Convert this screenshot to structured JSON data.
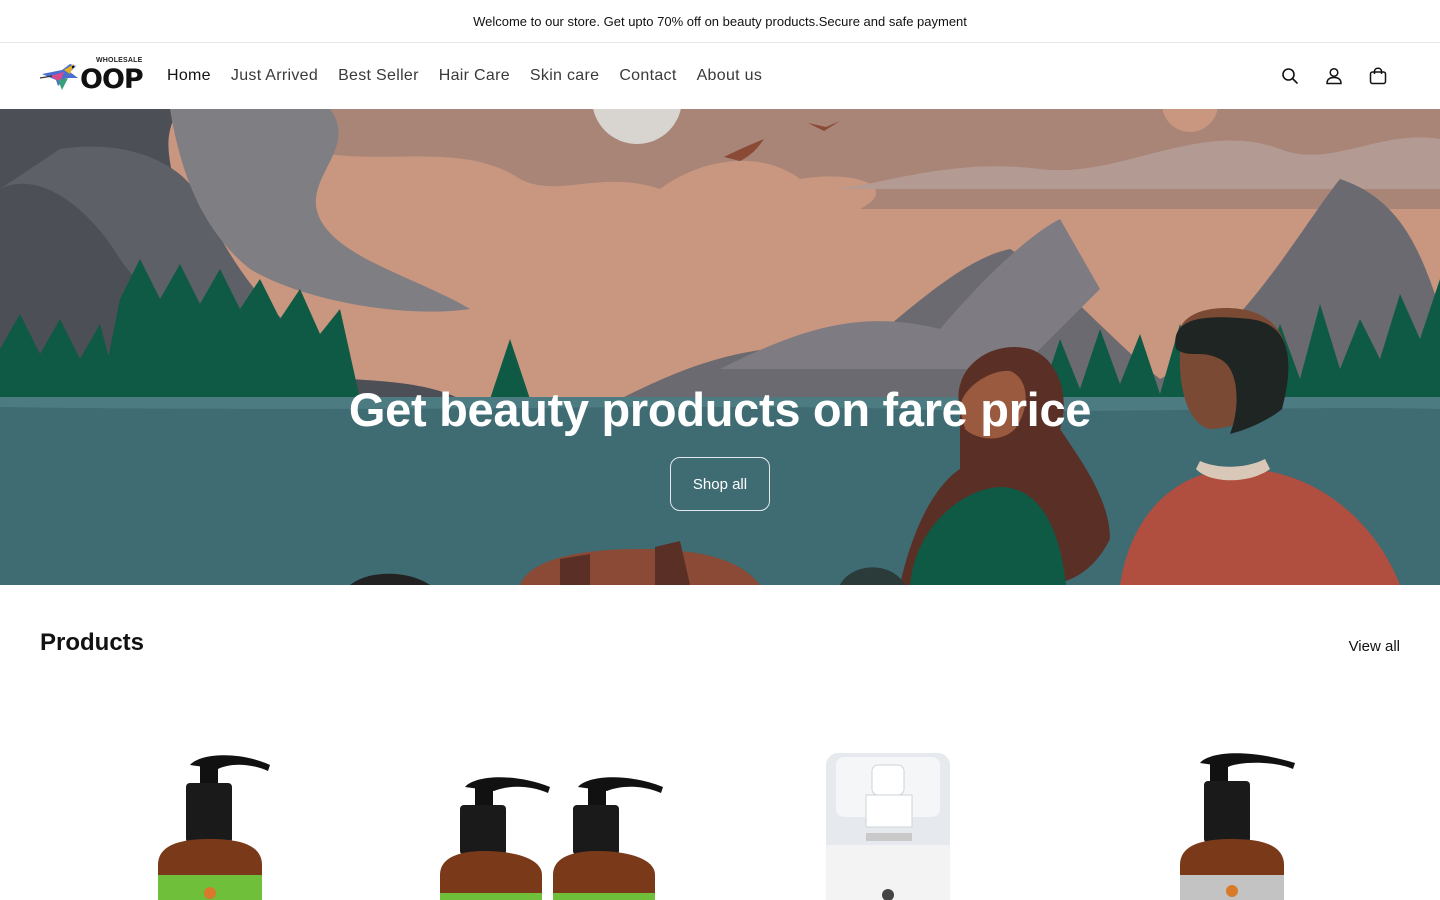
{
  "announcement": {
    "text": "Welcome to our store. Get upto 70% off on beauty products.Secure and safe payment"
  },
  "header": {
    "logo_text": "OOP",
    "logo_sub": "WHOLESALE",
    "nav": [
      {
        "label": "Home",
        "active": true
      },
      {
        "label": "Just Arrived"
      },
      {
        "label": "Best Seller"
      },
      {
        "label": "Hair Care"
      },
      {
        "label": "Skin care"
      },
      {
        "label": "Contact"
      },
      {
        "label": "About us"
      }
    ],
    "icons": [
      "search-icon",
      "account-icon",
      "cart-icon"
    ]
  },
  "hero": {
    "title": "Get beauty products on fare price",
    "button_label": "Shop all"
  },
  "products": {
    "title": "Products",
    "view_all_label": "View all"
  },
  "colors": {
    "hero_water": "#3f6b73",
    "hero_sky": "#d7a58d",
    "trees": "#0e5a45",
    "bottle_amber": "#7a3a1a",
    "label_green": "#6fbf3a"
  }
}
